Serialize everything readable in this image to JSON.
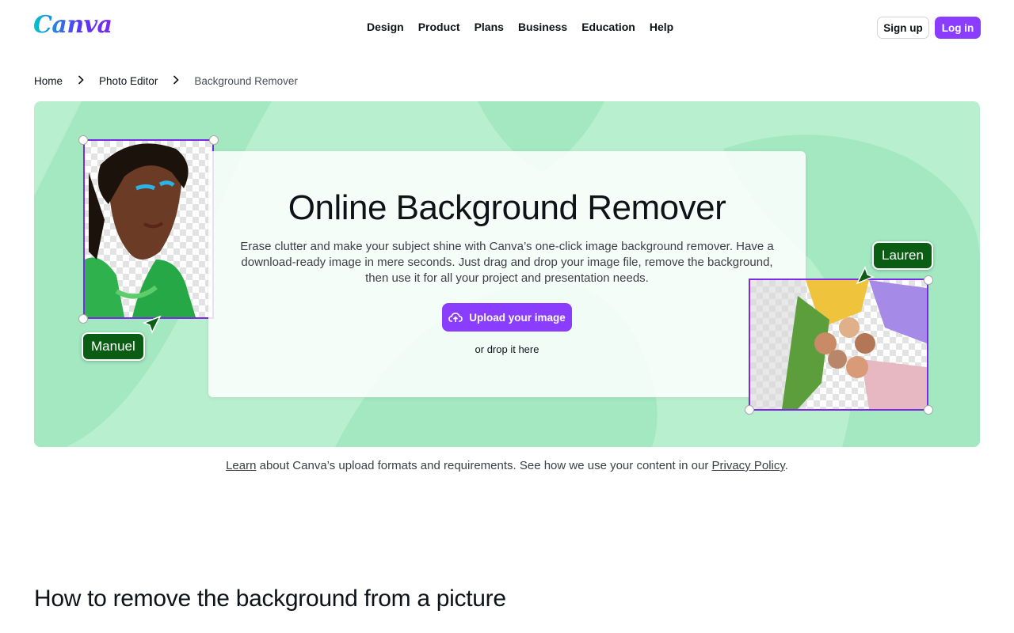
{
  "brand": {
    "logo_text": "Canva",
    "accent": "#8b3dff"
  },
  "nav": {
    "items": [
      "Design",
      "Product",
      "Plans",
      "Business",
      "Education",
      "Help"
    ]
  },
  "auth": {
    "signup": "Sign up",
    "login": "Log in"
  },
  "breadcrumb": {
    "items": [
      "Home",
      "Photo Editor",
      "Background Remover"
    ]
  },
  "hero": {
    "title": "Online Background Remover",
    "description": "Erase clutter and make your subject shine with Canva’s one-click image background remover. Have a download-ready image in mere seconds. Just drag and drop your image file, remove the background, then use it for all your project and presentation needs.",
    "upload_label": "Upload your image",
    "upload_icon": "cloud-upload-icon",
    "drop_text": "or drop it here",
    "tag_left": "Manuel",
    "tag_right": "Lauren"
  },
  "legal": {
    "learn": "Learn",
    "middle": " about Canva’s upload formats and requirements. See how we use your content in our ",
    "privacy": "Privacy Policy",
    "end": "."
  },
  "section": {
    "title": "How to remove the background from a picture"
  }
}
